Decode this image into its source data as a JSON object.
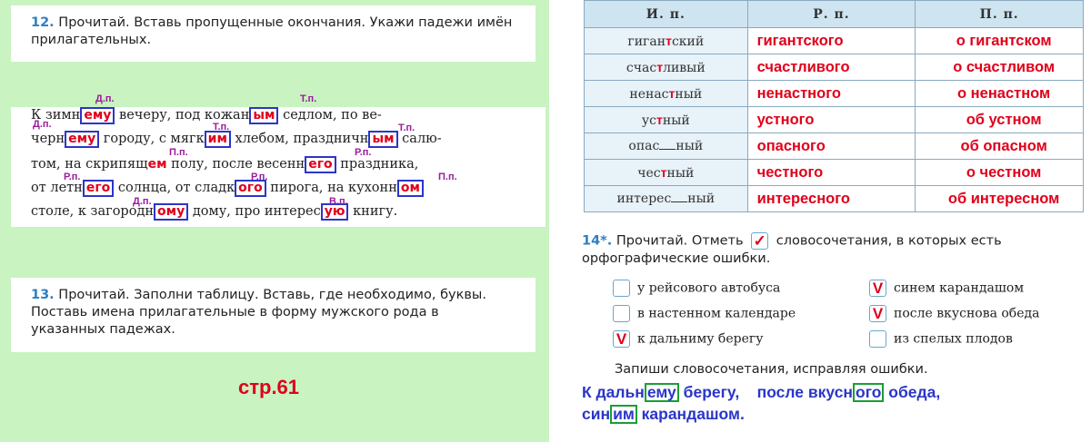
{
  "task12": {
    "number": "12.",
    "text": "Прочитай. Вставь пропущенные окончания. Укажи падежи имён прилагательных.",
    "lines": [
      {
        "parts": [
          "К зимн",
          "ему",
          " вечеру, под кожан",
          "ым",
          " седлом, по ве-"
        ]
      },
      {
        "parts": [
          "черн",
          "ему",
          " городу, с мягк",
          "им",
          " хлебом, праздничн",
          "ым",
          " салю-"
        ]
      },
      {
        "parts": [
          "том, на скрипящ",
          "ем",
          " полу, после весенн",
          "его",
          " праздника,"
        ]
      },
      {
        "parts": [
          "от летн",
          "его",
          " солнца, от сладк",
          "ого",
          " пирога, на кухонн",
          "ом"
        ]
      },
      {
        "parts": [
          "столе, к загородн",
          "ому",
          " дому, про интерес",
          "ую",
          " книгу."
        ]
      }
    ],
    "cases": [
      "Д.п.",
      "Т.п.",
      "Д.п.",
      "Т.п.",
      "Т.п.",
      "П.п.",
      "Р.п.",
      "Р.п.",
      "Р.п.",
      "П.п.",
      "Д.п.",
      "В.п."
    ]
  },
  "task13": {
    "number": "13.",
    "text": "Прочитай. Заполни таблицу. Вставь, где необходимо, буквы. Поставь имена прилагательные в форму мужского рода в указанных падежах."
  },
  "page_label": "стр.61",
  "table": {
    "headers": [
      "И. п.",
      "Р. п.",
      "П. п."
    ],
    "rows": [
      {
        "nom_a": "гиган",
        "ins": "т",
        "nom_b": "ский",
        "gen": "гигантского",
        "prep": "о гигантском"
      },
      {
        "nom_a": "счас",
        "ins": "т",
        "nom_b": "ливый",
        "gen": "счастливого",
        "prep": "о счастливом"
      },
      {
        "nom_a": "ненас",
        "ins": "т",
        "nom_b": "ный",
        "gen": "ненастного",
        "prep": "о ненастном"
      },
      {
        "nom_a": "ус",
        "ins": "т",
        "nom_b": "ный",
        "gen": "устного",
        "prep": "об устном"
      },
      {
        "nom_a": "опас",
        "ins": "",
        "nom_b": "ный",
        "gen": "опасного",
        "prep": "об опасном"
      },
      {
        "nom_a": "чес",
        "ins": "т",
        "nom_b": "ный",
        "gen": "честного",
        "prep": "о честном"
      },
      {
        "nom_a": "интерес",
        "ins": "",
        "nom_b": "ный",
        "gen": "интересного",
        "prep": "об интересном"
      }
    ]
  },
  "task14": {
    "number": "14*.",
    "text_a": "Прочитай. Отметь",
    "text_b": "словосочетания, в которых есть орфографические ошибки.",
    "options": [
      {
        "text": "у рейсового автобуса",
        "mark": ""
      },
      {
        "text": "синем карандашом",
        "mark": "V"
      },
      {
        "text": "в настенном календаре",
        "mark": ""
      },
      {
        "text": "после вкуснова обеда",
        "mark": "V"
      },
      {
        "text": "к дальниму берегу",
        "mark": "V"
      },
      {
        "text": "из спелых плодов",
        "mark": ""
      }
    ],
    "instruction": "Запиши словосочетания, исправляя ошибки.",
    "answer_line1": [
      "К дальн",
      "ему",
      " берегу,    после вкусн",
      "ого",
      " обеда,"
    ],
    "answer_line2": [
      "син",
      "им",
      " карандашом."
    ]
  }
}
